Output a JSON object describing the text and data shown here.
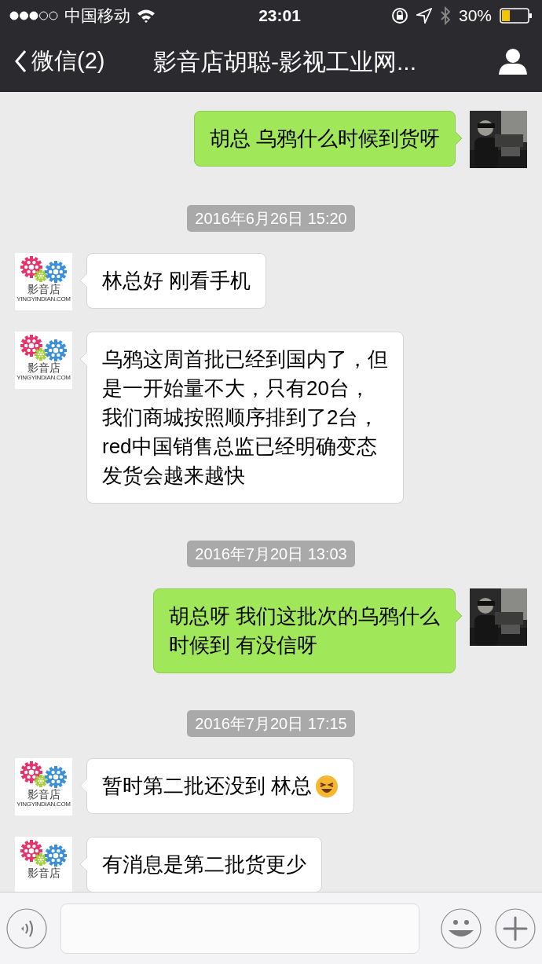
{
  "status_bar": {
    "carrier": "中国移动",
    "time": "23:01",
    "battery": "30%"
  },
  "nav": {
    "back": "微信(2)",
    "title": "影音店胡聪-影视工业网..."
  },
  "messages": [
    {
      "kind": "me",
      "lines": [
        "胡总 乌鸦什么时候到货呀"
      ]
    },
    {
      "kind": "time",
      "text": "2016年6月26日 15:20"
    },
    {
      "kind": "them",
      "logo": {
        "name": "影音店",
        "site": "YINGYINDIAN.COM"
      },
      "lines": [
        "林总好 刚看手机"
      ]
    },
    {
      "kind": "them",
      "logo": {
        "name": "影音店",
        "site": "YINGYINDIAN.COM"
      },
      "lines": [
        "乌鸦这周首批已经到国内了，但",
        "是一开始量不大，只有20台，",
        "我们商城按照顺序排到了2台，",
        "red中国销售总监已经明确变态",
        "发货会越来越快"
      ]
    },
    {
      "kind": "time",
      "text": "2016年7月20日 13:03"
    },
    {
      "kind": "me",
      "lines": [
        "胡总呀 我们这批次的乌鸦什么",
        "时候到 有没信呀"
      ]
    },
    {
      "kind": "time",
      "text": "2016年7月20日 17:15"
    },
    {
      "kind": "them",
      "logo": {
        "name": "影音店",
        "site": "YINGYINDIAN.COM"
      },
      "lines": [
        "暂时第二批还没到 林总"
      ],
      "emoji": true
    },
    {
      "kind": "them",
      "logo": {
        "name": "影音店"
      },
      "lines": [
        "有消息是第二批货更少"
      ]
    }
  ]
}
